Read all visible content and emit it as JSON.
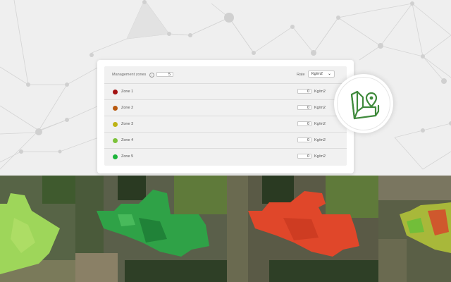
{
  "panel": {
    "zones_label": "Management zones",
    "info_symbol": "i",
    "zones_count": "5",
    "rate_label": "Rate",
    "unit_selected": "Kg/m2",
    "chevron": "⌄"
  },
  "zones": [
    {
      "label": "Zone 1",
      "value": "0",
      "unit": "Kg/m2",
      "color": "#a31212"
    },
    {
      "label": "Zone 2",
      "value": "0",
      "unit": "Kg/m2",
      "color": "#b8590f"
    },
    {
      "label": "Zone 3",
      "value": "0",
      "unit": "Kg/m2",
      "color": "#bdb315"
    },
    {
      "label": "Zone 4",
      "value": "0",
      "unit": "Kg/m2",
      "color": "#7cc23a"
    },
    {
      "label": "Zone 5",
      "value": "0",
      "unit": "Kg/m2",
      "color": "#1cb43a"
    }
  ],
  "badge": {
    "icon": "field-location-icon",
    "color": "#3f8a3c"
  },
  "fields": [
    {
      "name": "light-green-ndvi",
      "fill": "#9ed65a"
    },
    {
      "name": "dark-green-ndvi",
      "fill": "#2fa247"
    },
    {
      "name": "red-ndvi",
      "fill": "#e0472a"
    },
    {
      "name": "mixed-ndvi",
      "fill": "#a8b83a"
    }
  ]
}
